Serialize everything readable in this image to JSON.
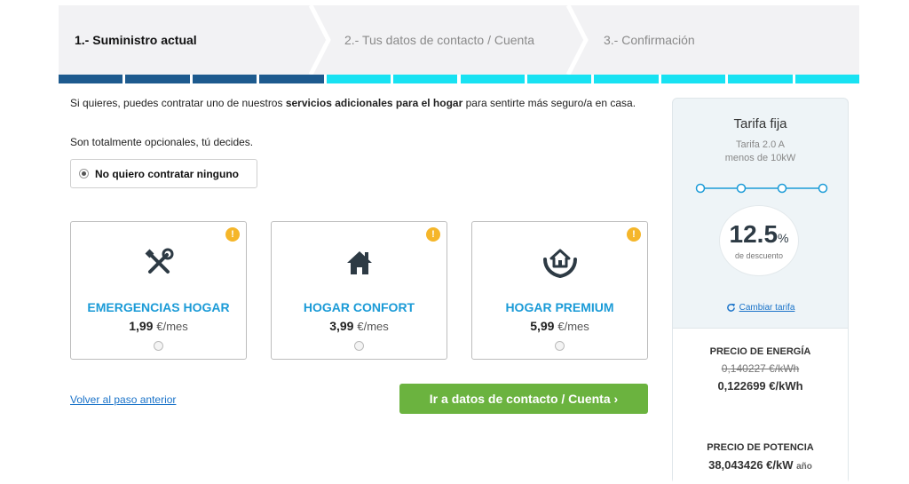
{
  "steps": [
    {
      "label": "1.- Suministro actual",
      "state": "active"
    },
    {
      "label": "2.- Tus datos de contacto / Cuenta",
      "state": "pending"
    },
    {
      "label": "3.- Confirmación",
      "state": "pending"
    }
  ],
  "progress": {
    "completed_segments": 4,
    "total_segments": 12,
    "done_color": "#1d5a8e",
    "todo_color": "#18e2f2"
  },
  "intro": {
    "text_before": "Si quieres, puedes contratar uno de nuestros ",
    "text_bold": "servicios adicionales para el hogar",
    "text_after": " para sentirte más seguro/a en casa.",
    "optional_note": "Son totalmente opcionales, tú decides."
  },
  "no_service_option": {
    "label": "No quiero contratar ninguno",
    "selected": true
  },
  "services": [
    {
      "name": "EMERGENCIAS HOGAR",
      "price": "1,99",
      "unit": "€/mes",
      "icon": "tools-icon",
      "selected": false
    },
    {
      "name": "HOGAR CONFORT",
      "price": "3,99",
      "unit": "€/mes",
      "icon": "house-icon",
      "selected": false
    },
    {
      "name": "HOGAR PREMIUM",
      "price": "5,99",
      "unit": "€/mes",
      "icon": "house-hands-icon",
      "selected": false
    }
  ],
  "info_badge": "!",
  "back_link": "Volver al paso anterior",
  "cta": {
    "label": "Ir a datos de contacto / Cuenta",
    "arrow": "›"
  },
  "tariff": {
    "title": "Tarifa fija",
    "subtitle1": "Tarifa 2.0 A",
    "subtitle2": "menos de 10kW",
    "discount_value": "12.5",
    "discount_symbol": "%",
    "discount_label": "de descuento",
    "change_label": "Cambiar tarifa",
    "energy": {
      "title": "PRECIO DE ENERGÍA",
      "old": "0,140227 €/kWh",
      "new": "0,122699 €/kWh"
    },
    "power": {
      "title": "PRECIO DE POTENCIA",
      "value": "38,043426 €/kW",
      "period": "año"
    }
  },
  "colors": {
    "accent_blue": "#1b9bd7",
    "cta_green": "#6bb33f",
    "info_yellow": "#f5b62a",
    "link_blue": "#1a73c9"
  }
}
